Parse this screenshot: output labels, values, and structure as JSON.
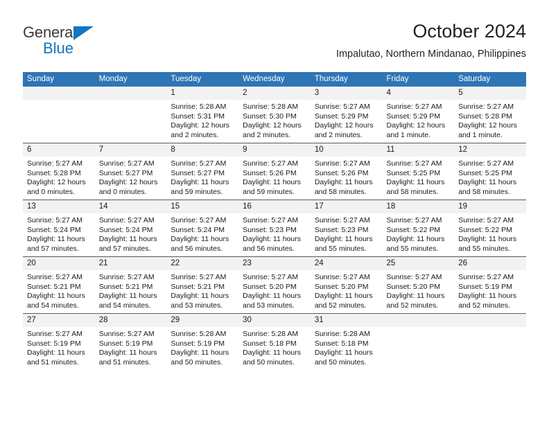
{
  "brand": {
    "name_top": "General",
    "name_bottom": "Blue",
    "logo_icon": "blue-triangle-icon",
    "accent_color": "#1176c4"
  },
  "header": {
    "title": "October 2024",
    "subtitle": "Impalutao, Northern Mindanao, Philippines"
  },
  "calendar": {
    "header_color": "#2e75b6",
    "daynum_band_color": "#f2f2f2",
    "weekdays": [
      "Sunday",
      "Monday",
      "Tuesday",
      "Wednesday",
      "Thursday",
      "Friday",
      "Saturday"
    ],
    "labels": {
      "sunrise": "Sunrise:",
      "sunset": "Sunset:",
      "daylight": "Daylight:"
    },
    "weeks": [
      [
        {
          "day": "",
          "empty": true
        },
        {
          "day": "",
          "empty": true
        },
        {
          "day": "1",
          "sunrise": "Sunrise: 5:28 AM",
          "sunset": "Sunset: 5:31 PM",
          "daylight_1": "Daylight: 12 hours",
          "daylight_2": "and 2 minutes."
        },
        {
          "day": "2",
          "sunrise": "Sunrise: 5:28 AM",
          "sunset": "Sunset: 5:30 PM",
          "daylight_1": "Daylight: 12 hours",
          "daylight_2": "and 2 minutes."
        },
        {
          "day": "3",
          "sunrise": "Sunrise: 5:27 AM",
          "sunset": "Sunset: 5:29 PM",
          "daylight_1": "Daylight: 12 hours",
          "daylight_2": "and 2 minutes."
        },
        {
          "day": "4",
          "sunrise": "Sunrise: 5:27 AM",
          "sunset": "Sunset: 5:29 PM",
          "daylight_1": "Daylight: 12 hours",
          "daylight_2": "and 1 minute."
        },
        {
          "day": "5",
          "sunrise": "Sunrise: 5:27 AM",
          "sunset": "Sunset: 5:28 PM",
          "daylight_1": "Daylight: 12 hours",
          "daylight_2": "and 1 minute."
        }
      ],
      [
        {
          "day": "6",
          "sunrise": "Sunrise: 5:27 AM",
          "sunset": "Sunset: 5:28 PM",
          "daylight_1": "Daylight: 12 hours",
          "daylight_2": "and 0 minutes."
        },
        {
          "day": "7",
          "sunrise": "Sunrise: 5:27 AM",
          "sunset": "Sunset: 5:27 PM",
          "daylight_1": "Daylight: 12 hours",
          "daylight_2": "and 0 minutes."
        },
        {
          "day": "8",
          "sunrise": "Sunrise: 5:27 AM",
          "sunset": "Sunset: 5:27 PM",
          "daylight_1": "Daylight: 11 hours",
          "daylight_2": "and 59 minutes."
        },
        {
          "day": "9",
          "sunrise": "Sunrise: 5:27 AM",
          "sunset": "Sunset: 5:26 PM",
          "daylight_1": "Daylight: 11 hours",
          "daylight_2": "and 59 minutes."
        },
        {
          "day": "10",
          "sunrise": "Sunrise: 5:27 AM",
          "sunset": "Sunset: 5:26 PM",
          "daylight_1": "Daylight: 11 hours",
          "daylight_2": "and 58 minutes."
        },
        {
          "day": "11",
          "sunrise": "Sunrise: 5:27 AM",
          "sunset": "Sunset: 5:25 PM",
          "daylight_1": "Daylight: 11 hours",
          "daylight_2": "and 58 minutes."
        },
        {
          "day": "12",
          "sunrise": "Sunrise: 5:27 AM",
          "sunset": "Sunset: 5:25 PM",
          "daylight_1": "Daylight: 11 hours",
          "daylight_2": "and 58 minutes."
        }
      ],
      [
        {
          "day": "13",
          "sunrise": "Sunrise: 5:27 AM",
          "sunset": "Sunset: 5:24 PM",
          "daylight_1": "Daylight: 11 hours",
          "daylight_2": "and 57 minutes."
        },
        {
          "day": "14",
          "sunrise": "Sunrise: 5:27 AM",
          "sunset": "Sunset: 5:24 PM",
          "daylight_1": "Daylight: 11 hours",
          "daylight_2": "and 57 minutes."
        },
        {
          "day": "15",
          "sunrise": "Sunrise: 5:27 AM",
          "sunset": "Sunset: 5:24 PM",
          "daylight_1": "Daylight: 11 hours",
          "daylight_2": "and 56 minutes."
        },
        {
          "day": "16",
          "sunrise": "Sunrise: 5:27 AM",
          "sunset": "Sunset: 5:23 PM",
          "daylight_1": "Daylight: 11 hours",
          "daylight_2": "and 56 minutes."
        },
        {
          "day": "17",
          "sunrise": "Sunrise: 5:27 AM",
          "sunset": "Sunset: 5:23 PM",
          "daylight_1": "Daylight: 11 hours",
          "daylight_2": "and 55 minutes."
        },
        {
          "day": "18",
          "sunrise": "Sunrise: 5:27 AM",
          "sunset": "Sunset: 5:22 PM",
          "daylight_1": "Daylight: 11 hours",
          "daylight_2": "and 55 minutes."
        },
        {
          "day": "19",
          "sunrise": "Sunrise: 5:27 AM",
          "sunset": "Sunset: 5:22 PM",
          "daylight_1": "Daylight: 11 hours",
          "daylight_2": "and 55 minutes."
        }
      ],
      [
        {
          "day": "20",
          "sunrise": "Sunrise: 5:27 AM",
          "sunset": "Sunset: 5:21 PM",
          "daylight_1": "Daylight: 11 hours",
          "daylight_2": "and 54 minutes."
        },
        {
          "day": "21",
          "sunrise": "Sunrise: 5:27 AM",
          "sunset": "Sunset: 5:21 PM",
          "daylight_1": "Daylight: 11 hours",
          "daylight_2": "and 54 minutes."
        },
        {
          "day": "22",
          "sunrise": "Sunrise: 5:27 AM",
          "sunset": "Sunset: 5:21 PM",
          "daylight_1": "Daylight: 11 hours",
          "daylight_2": "and 53 minutes."
        },
        {
          "day": "23",
          "sunrise": "Sunrise: 5:27 AM",
          "sunset": "Sunset: 5:20 PM",
          "daylight_1": "Daylight: 11 hours",
          "daylight_2": "and 53 minutes."
        },
        {
          "day": "24",
          "sunrise": "Sunrise: 5:27 AM",
          "sunset": "Sunset: 5:20 PM",
          "daylight_1": "Daylight: 11 hours",
          "daylight_2": "and 52 minutes."
        },
        {
          "day": "25",
          "sunrise": "Sunrise: 5:27 AM",
          "sunset": "Sunset: 5:20 PM",
          "daylight_1": "Daylight: 11 hours",
          "daylight_2": "and 52 minutes."
        },
        {
          "day": "26",
          "sunrise": "Sunrise: 5:27 AM",
          "sunset": "Sunset: 5:19 PM",
          "daylight_1": "Daylight: 11 hours",
          "daylight_2": "and 52 minutes."
        }
      ],
      [
        {
          "day": "27",
          "sunrise": "Sunrise: 5:27 AM",
          "sunset": "Sunset: 5:19 PM",
          "daylight_1": "Daylight: 11 hours",
          "daylight_2": "and 51 minutes."
        },
        {
          "day": "28",
          "sunrise": "Sunrise: 5:27 AM",
          "sunset": "Sunset: 5:19 PM",
          "daylight_1": "Daylight: 11 hours",
          "daylight_2": "and 51 minutes."
        },
        {
          "day": "29",
          "sunrise": "Sunrise: 5:28 AM",
          "sunset": "Sunset: 5:19 PM",
          "daylight_1": "Daylight: 11 hours",
          "daylight_2": "and 50 minutes."
        },
        {
          "day": "30",
          "sunrise": "Sunrise: 5:28 AM",
          "sunset": "Sunset: 5:18 PM",
          "daylight_1": "Daylight: 11 hours",
          "daylight_2": "and 50 minutes."
        },
        {
          "day": "31",
          "sunrise": "Sunrise: 5:28 AM",
          "sunset": "Sunset: 5:18 PM",
          "daylight_1": "Daylight: 11 hours",
          "daylight_2": "and 50 minutes."
        },
        {
          "day": "",
          "empty": true
        },
        {
          "day": "",
          "empty": true
        }
      ]
    ]
  }
}
